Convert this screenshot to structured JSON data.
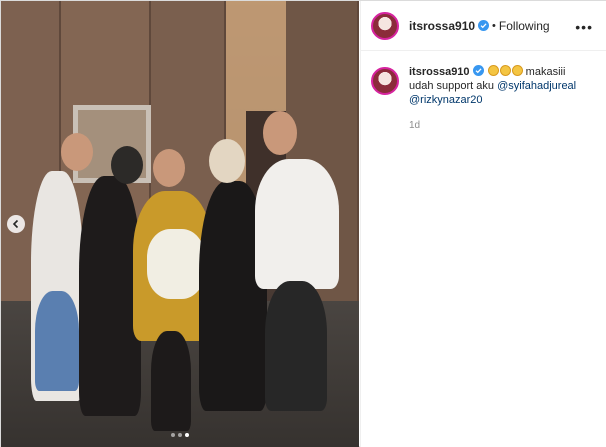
{
  "post": {
    "username": "itsrossa910",
    "follow_status": "Following",
    "more_label": "•••",
    "caption": {
      "username": "itsrossa910",
      "text_before": "makasiii udah support aku",
      "mentions": [
        "@syifahadjureal",
        "@rizkynazar20"
      ],
      "time": "1d"
    },
    "carousel": {
      "total": 3,
      "active_index": 2
    }
  },
  "colors": {
    "mention": "#00376b",
    "verified": "#3897f0",
    "time": "#8e8e8e"
  }
}
